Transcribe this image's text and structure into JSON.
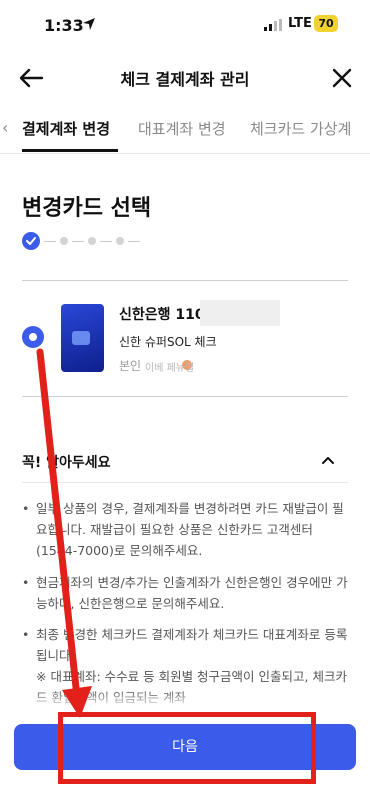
{
  "status_bar": {
    "time": "1:33",
    "network": "LTE",
    "battery": "70"
  },
  "header": {
    "title": "체크 결제계좌 관리"
  },
  "tabs": [
    {
      "label": "결제계좌 변경",
      "active": true
    },
    {
      "label": "대표계좌 변경",
      "active": false
    },
    {
      "label": "체크카드 가상계",
      "active": false
    }
  ],
  "section": {
    "title": "변경카드 선택",
    "current_step": 1,
    "total_steps": 5
  },
  "card": {
    "bank_account": "신한은행 110",
    "product_name": "신한 슈퍼SOL 체크",
    "owner_label": "본인",
    "watermark": "이베 페뉴얼"
  },
  "notice": {
    "title": "꼭! 알아두세요",
    "items": [
      {
        "bullet": "•",
        "text": "일부 상품의 경우, 결제계좌를 변경하려면 카드 재발급이 필요합니다. 재발급이 필요한 상품은 신한카드 고객센터(1544-7000)로 문의해주세요."
      },
      {
        "bullet": "•",
        "text": "현금계좌의 변경/추가는 인출계좌가 신한은행인 경우에만 가능하며, 신한은행으로 문의해주세요."
      },
      {
        "bullet": "•",
        "text": "최종 변경한 체크카드 결제계좌가 체크카드 대표계좌로 등록됩니다."
      }
    ],
    "sub_note": "※ 대표계좌: 수수료 등 회원별 청구금액이 인출되고, 체크카드 환입금액이 입금되는 계좌"
  },
  "footer": {
    "next_button": "다음"
  },
  "colors": {
    "accent": "#3b5ce8",
    "annotation": "#e2211b",
    "battery": "#f2d230"
  }
}
